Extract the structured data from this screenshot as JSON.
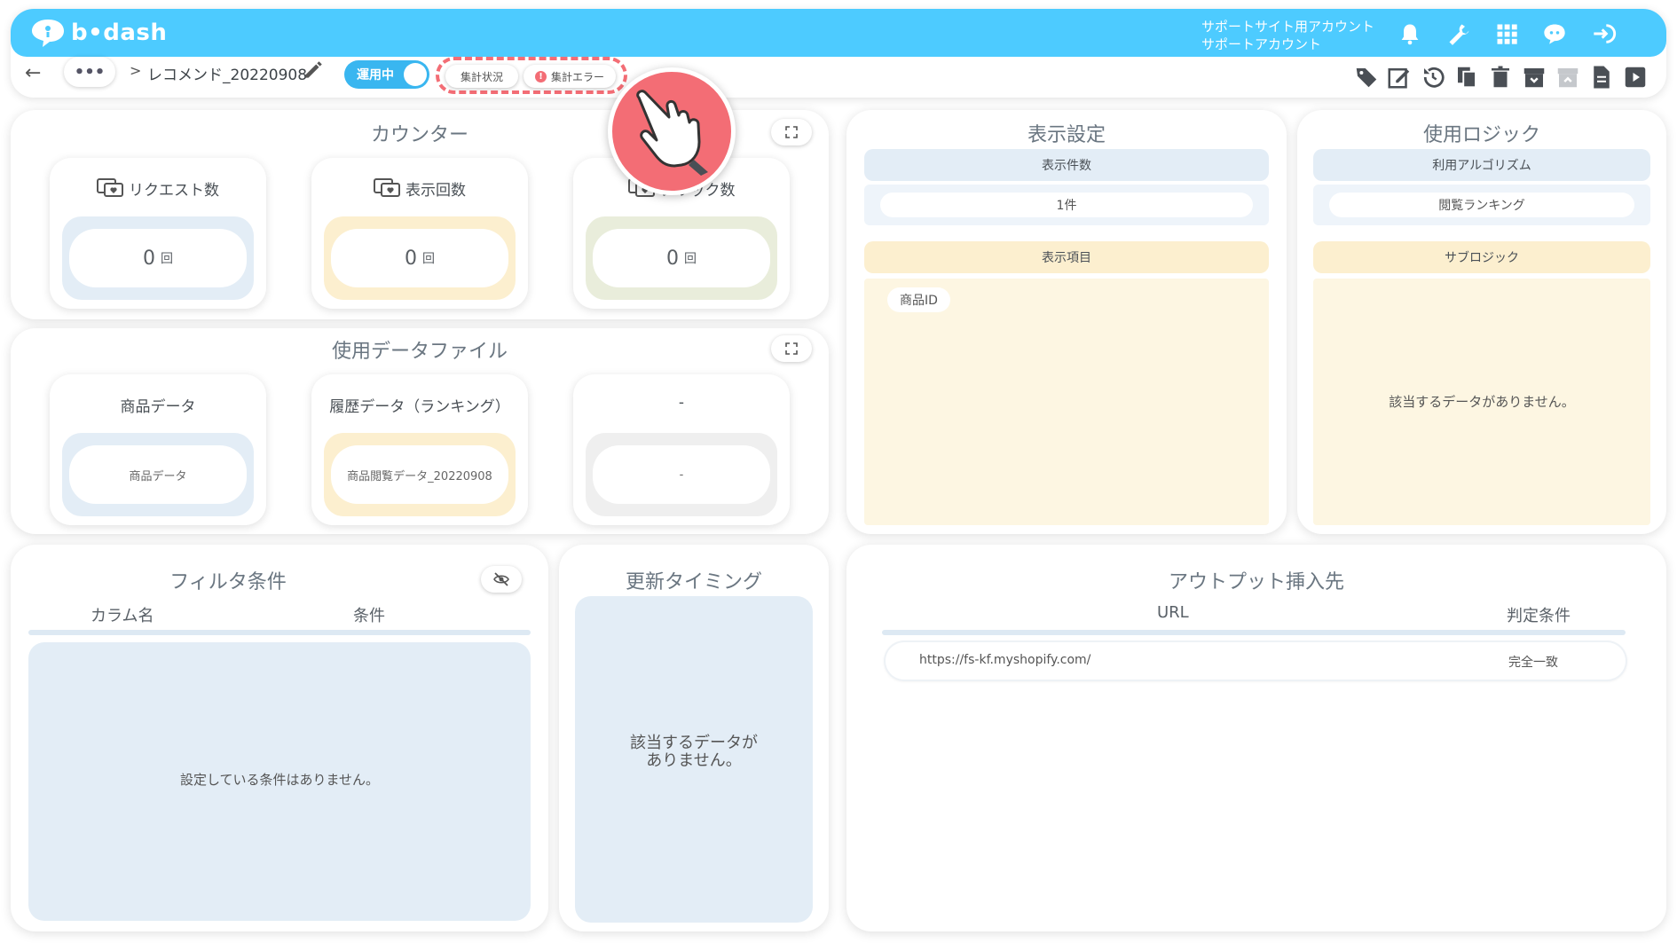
{
  "app": {
    "logo_text": "b•dash",
    "account_line1": "サポートサイト用アカウント",
    "account_line2": "サポートアカウント"
  },
  "header_icons": [
    "bell-icon",
    "wrench-icon",
    "grid-icon",
    "chat-face-icon",
    "logout-icon"
  ],
  "breadcrumb": {
    "more": "•••",
    "separator": ">",
    "title": "レコメンド_20220908"
  },
  "status": {
    "toggle_label": "運用中",
    "aggregate_status": "集計状況",
    "aggregate_error": "集計エラー",
    "error_mark": "!"
  },
  "toolbar_icons": [
    "tag-icon",
    "edit-icon",
    "history-icon",
    "copy-icon",
    "trash-icon",
    "archive-icon",
    "archive-disabled-icon",
    "document-icon",
    "play-icon"
  ],
  "counter": {
    "title": "カウンター",
    "cards": [
      {
        "label": "リクエスト数",
        "value": "0",
        "unit": "回",
        "well": "blue"
      },
      {
        "label": "表示回数",
        "value": "0",
        "unit": "回",
        "well": "yellow"
      },
      {
        "label": "クリック数",
        "value": "0",
        "unit": "回",
        "well": "green"
      }
    ]
  },
  "data_files": {
    "title": "使用データファイル",
    "cards": [
      {
        "label": "商品データ",
        "value": "商品データ",
        "well": "blue"
      },
      {
        "label": "履歴データ（ランキング）",
        "value": "商品閲覧データ_20220908",
        "well": "yellow"
      },
      {
        "label": "-",
        "value": "-",
        "well": "grey"
      }
    ]
  },
  "display_settings": {
    "title": "表示設定",
    "count_header": "表示件数",
    "count_value": "1件",
    "items_header": "表示項目",
    "items": [
      "商品ID"
    ]
  },
  "logic": {
    "title": "使用ロジック",
    "algorithm_header": "利用アルゴリズム",
    "algorithm_value": "閲覧ランキング",
    "sublogic_header": "サブロジック",
    "sublogic_empty": "該当するデータがありません。"
  },
  "filter": {
    "title": "フィルタ条件",
    "col_name": "カラム名",
    "col_condition": "条件",
    "empty": "設定している条件はありません。"
  },
  "timing": {
    "title": "更新タイミング",
    "empty_line1": "該当するデータが",
    "empty_line2": "ありません。"
  },
  "output": {
    "title": "アウトプット挿入先",
    "col_url": "URL",
    "col_condition": "判定条件",
    "rows": [
      {
        "url": "https://fs-kf.myshopify.com/",
        "condition": "完全一致"
      }
    ]
  },
  "colors": {
    "brand": "#4dcbff",
    "toggle": "#39b6f0",
    "highlight": "#f36d75"
  }
}
